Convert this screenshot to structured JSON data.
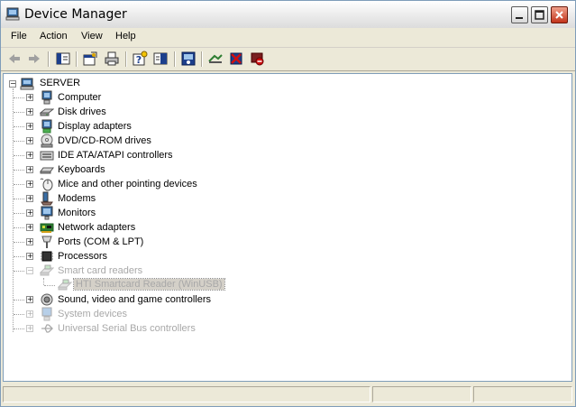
{
  "window": {
    "title": "Device Manager"
  },
  "menu": [
    "File",
    "Action",
    "View",
    "Help"
  ],
  "toolbar_icons": [
    "back-arrow-icon",
    "forward-arrow-icon",
    "show-hide-console-tree-icon",
    "properties-icon",
    "print-icon",
    "help-icon",
    "console-tree-icon",
    "scan-hardware-icon",
    "update-driver-icon",
    "uninstall-icon",
    "disable-device-icon"
  ],
  "tree": {
    "root": "SERVER",
    "categories": [
      {
        "label": "Computer",
        "disabled": false
      },
      {
        "label": "Disk drives",
        "disabled": false
      },
      {
        "label": "Display adapters",
        "disabled": false
      },
      {
        "label": "DVD/CD-ROM drives",
        "disabled": false
      },
      {
        "label": "IDE ATA/ATAPI controllers",
        "disabled": false
      },
      {
        "label": "Keyboards",
        "disabled": false
      },
      {
        "label": "Mice and other pointing devices",
        "disabled": false
      },
      {
        "label": "Modems",
        "disabled": false
      },
      {
        "label": "Monitors",
        "disabled": false
      },
      {
        "label": "Network adapters",
        "disabled": false
      },
      {
        "label": "Ports (COM & LPT)",
        "disabled": false
      },
      {
        "label": "Processors",
        "disabled": false
      },
      {
        "label": "Smart card readers",
        "disabled": true,
        "expanded": true,
        "children": [
          "HTI Smartcard Reader (WinUSB)"
        ]
      },
      {
        "label": "Sound, video and game controllers",
        "disabled": false
      },
      {
        "label": "System devices",
        "disabled": true
      },
      {
        "label": "Universal Serial Bus controllers",
        "disabled": true
      }
    ]
  },
  "colors": {
    "title_bar": "#f2f2f2",
    "close_button": "#c2331a",
    "window_bg": "#ece9d8",
    "disabled_text": "#a8a8a8"
  }
}
